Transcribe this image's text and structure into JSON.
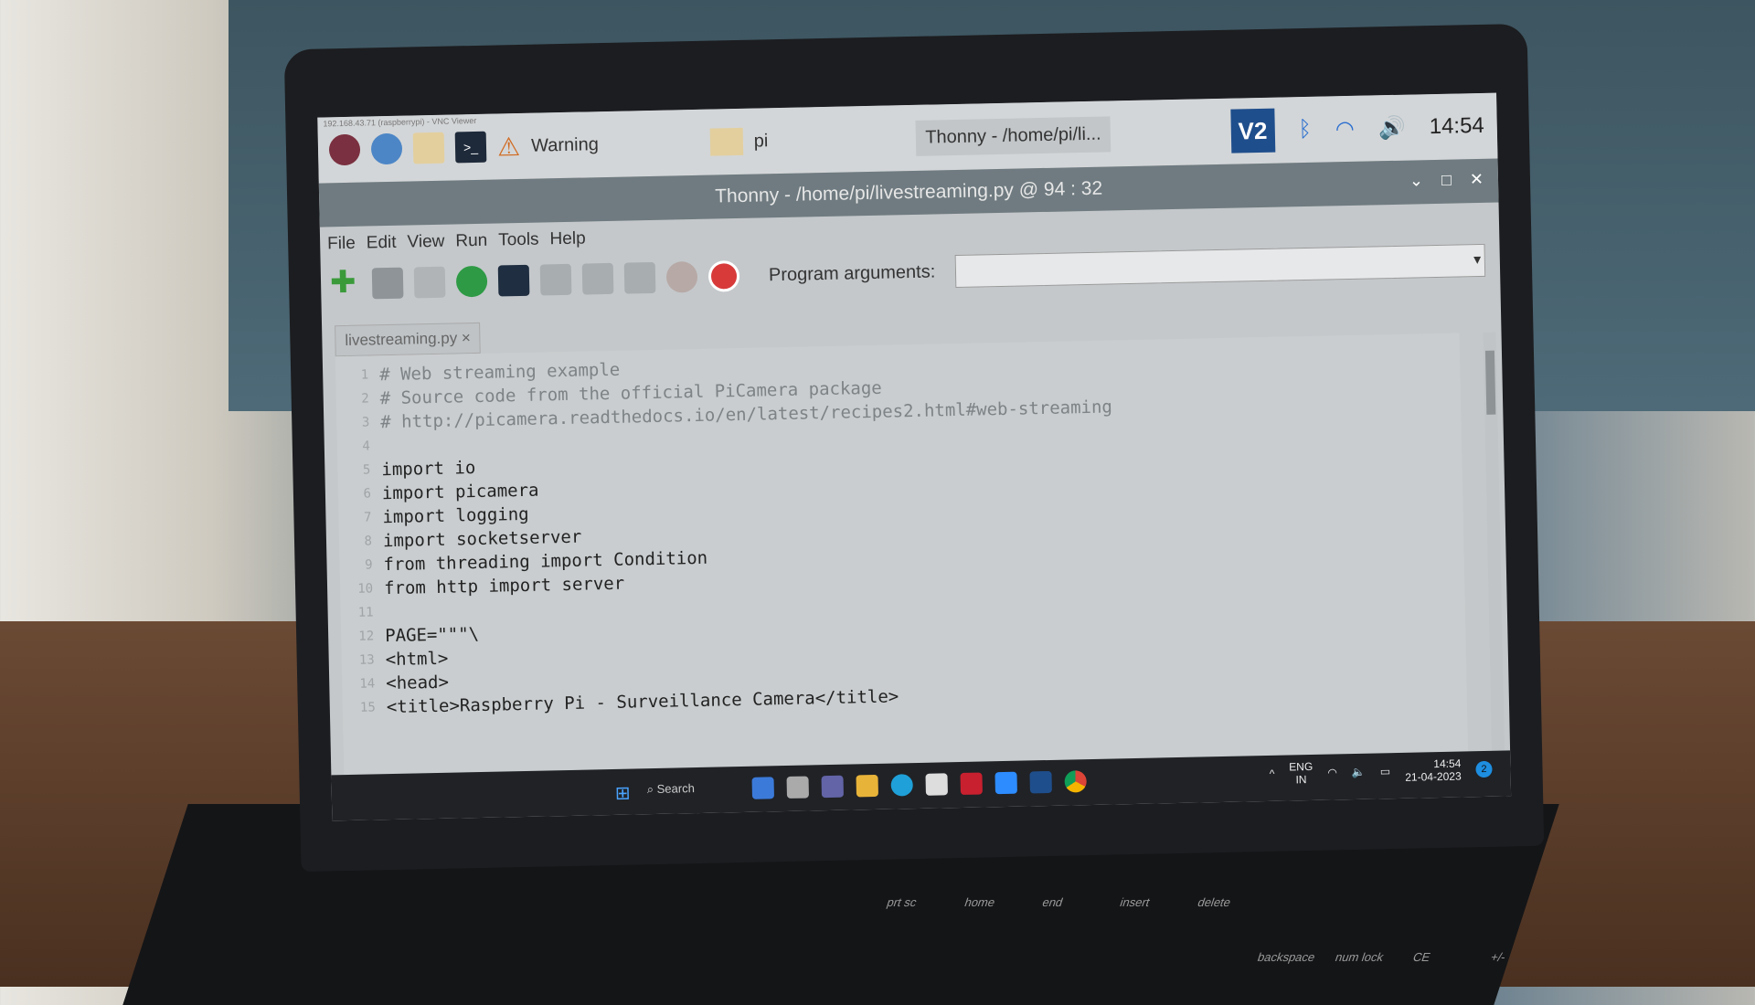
{
  "vnc_title": "192.168.43.71 (raspberrypi) - VNC Viewer",
  "pi_taskbar": {
    "warning": "Warning",
    "folder": "pi",
    "thonny_task": "Thonny - /home/pi/li...",
    "clock": "14:54",
    "vnc_icon": "V2"
  },
  "window": {
    "title": "Thonny - /home/pi/livestreaming.py @ 94 : 32"
  },
  "menu": [
    "File",
    "Edit",
    "View",
    "Run",
    "Tools",
    "Help"
  ],
  "toolbar": {
    "program_args_label": "Program arguments:",
    "program_args_value": ""
  },
  "tab": {
    "label": "livestreaming.py ×"
  },
  "code": [
    {
      "n": "1",
      "t": "# Web streaming example",
      "c": true
    },
    {
      "n": "2",
      "t": "# Source code from the official PiCamera package",
      "c": true
    },
    {
      "n": "3",
      "t": "# http://picamera.readthedocs.io/en/latest/recipes2.html#web-streaming",
      "c": true
    },
    {
      "n": "4",
      "t": "",
      "c": false
    },
    {
      "n": "5",
      "t": "import io",
      "c": false
    },
    {
      "n": "6",
      "t": "import picamera",
      "c": false
    },
    {
      "n": "7",
      "t": "import logging",
      "c": false
    },
    {
      "n": "8",
      "t": "import socketserver",
      "c": false
    },
    {
      "n": "9",
      "t": "from threading import Condition",
      "c": false
    },
    {
      "n": "10",
      "t": "from http import server",
      "c": false
    },
    {
      "n": "11",
      "t": "",
      "c": false
    },
    {
      "n": "12",
      "t": "PAGE=\"\"\"\\",
      "c": false
    },
    {
      "n": "13",
      "t": "<html>",
      "c": false
    },
    {
      "n": "14",
      "t": "<head>",
      "c": false
    },
    {
      "n": "15",
      "t": "<title>Raspberry Pi - Surveillance Camera</title>",
      "c": false
    }
  ],
  "windows_taskbar": {
    "search": "Search",
    "lang1": "ENG",
    "lang2": "IN",
    "time": "14:54",
    "date": "21-04-2023",
    "notifications": "2"
  },
  "keyboard": [
    "prt sc",
    "home",
    "end",
    "insert",
    "delete",
    "backspace",
    "num lock",
    "CE",
    "+/-"
  ]
}
